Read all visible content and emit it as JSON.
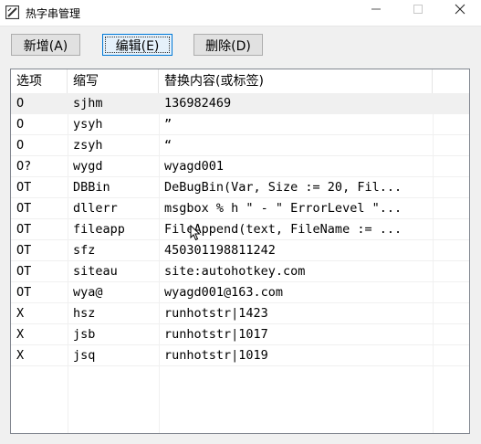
{
  "window": {
    "title": "热字串管理",
    "min_icon": "minimize-icon",
    "max_icon": "maximize-icon",
    "close_icon": "close-icon"
  },
  "toolbar": {
    "add_label": "新增(A)",
    "edit_label": "编辑(E)",
    "delete_label": "删除(D)"
  },
  "table": {
    "columns": [
      "选项",
      "缩写",
      "替换内容(或标签)"
    ],
    "rows": [
      {
        "option": "O",
        "abbr": "sjhm",
        "content": "136982469"
      },
      {
        "option": "O",
        "abbr": "ysyh",
        "content": "”"
      },
      {
        "option": "O",
        "abbr": "zsyh",
        "content": "“"
      },
      {
        "option": "O?",
        "abbr": "wygd",
        "content": "wyagd001"
      },
      {
        "option": "OT",
        "abbr": "DBBin",
        "content": "DeBugBin(Var, Size := 20, Fil..."
      },
      {
        "option": "OT",
        "abbr": "dllerr",
        "content": "msgbox % h \" - \" ErrorLevel \"..."
      },
      {
        "option": "OT",
        "abbr": "fileapp",
        "content": "FileAppend(text, FileName := ..."
      },
      {
        "option": "OT",
        "abbr": "sfz",
        "content": "450301198811242"
      },
      {
        "option": "OT",
        "abbr": "siteau",
        "content": "site:autohotkey.com"
      },
      {
        "option": "OT",
        "abbr": "wya@",
        "content": "wyagd001@163.com"
      },
      {
        "option": "X",
        "abbr": "hsz",
        "content": "runhotstr|1423"
      },
      {
        "option": "X",
        "abbr": "jsb",
        "content": "runhotstr|1017"
      },
      {
        "option": "X",
        "abbr": "jsq",
        "content": "runhotstr|1019"
      }
    ],
    "selected_row": 0
  }
}
